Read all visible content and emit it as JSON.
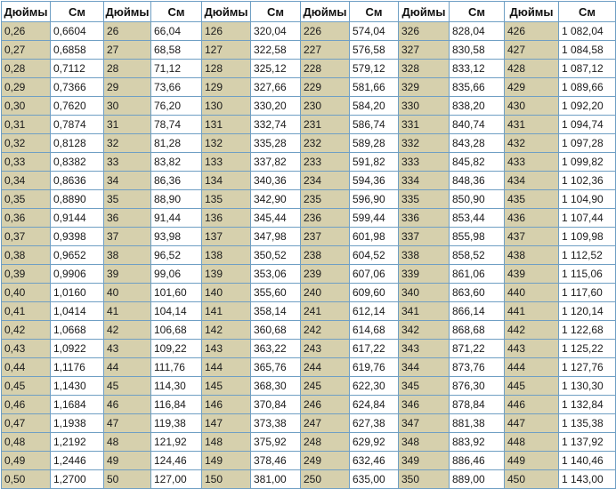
{
  "table": {
    "headers": [
      "Дюймы",
      "См",
      "Дюймы",
      "См",
      "Дюймы",
      "См",
      "Дюймы",
      "См",
      "Дюймы",
      "См",
      "Дюймы",
      "См"
    ],
    "rows": [
      [
        "0,26",
        "0,6604",
        "26",
        "66,04",
        "126",
        "320,04",
        "226",
        "574,04",
        "326",
        "828,04",
        "426",
        "1 082,04"
      ],
      [
        "0,27",
        "0,6858",
        "27",
        "68,58",
        "127",
        "322,58",
        "227",
        "576,58",
        "327",
        "830,58",
        "427",
        "1 084,58"
      ],
      [
        "0,28",
        "0,7112",
        "28",
        "71,12",
        "128",
        "325,12",
        "228",
        "579,12",
        "328",
        "833,12",
        "428",
        "1 087,12"
      ],
      [
        "0,29",
        "0,7366",
        "29",
        "73,66",
        "129",
        "327,66",
        "229",
        "581,66",
        "329",
        "835,66",
        "429",
        "1 089,66"
      ],
      [
        "0,30",
        "0,7620",
        "30",
        "76,20",
        "130",
        "330,20",
        "230",
        "584,20",
        "330",
        "838,20",
        "430",
        "1 092,20"
      ],
      [
        "0,31",
        "0,7874",
        "31",
        "78,74",
        "131",
        "332,74",
        "231",
        "586,74",
        "331",
        "840,74",
        "431",
        "1 094,74"
      ],
      [
        "0,32",
        "0,8128",
        "32",
        "81,28",
        "132",
        "335,28",
        "232",
        "589,28",
        "332",
        "843,28",
        "432",
        "1 097,28"
      ],
      [
        "0,33",
        "0,8382",
        "33",
        "83,82",
        "133",
        "337,82",
        "233",
        "591,82",
        "333",
        "845,82",
        "433",
        "1 099,82"
      ],
      [
        "0,34",
        "0,8636",
        "34",
        "86,36",
        "134",
        "340,36",
        "234",
        "594,36",
        "334",
        "848,36",
        "434",
        "1 102,36"
      ],
      [
        "0,35",
        "0,8890",
        "35",
        "88,90",
        "135",
        "342,90",
        "235",
        "596,90",
        "335",
        "850,90",
        "435",
        "1 104,90"
      ],
      [
        "0,36",
        "0,9144",
        "36",
        "91,44",
        "136",
        "345,44",
        "236",
        "599,44",
        "336",
        "853,44",
        "436",
        "1 107,44"
      ],
      [
        "0,37",
        "0,9398",
        "37",
        "93,98",
        "137",
        "347,98",
        "237",
        "601,98",
        "337",
        "855,98",
        "437",
        "1 109,98"
      ],
      [
        "0,38",
        "0,9652",
        "38",
        "96,52",
        "138",
        "350,52",
        "238",
        "604,52",
        "338",
        "858,52",
        "438",
        "1 112,52"
      ],
      [
        "0,39",
        "0,9906",
        "39",
        "99,06",
        "139",
        "353,06",
        "239",
        "607,06",
        "339",
        "861,06",
        "439",
        "1 115,06"
      ],
      [
        "0,40",
        "1,0160",
        "40",
        "101,60",
        "140",
        "355,60",
        "240",
        "609,60",
        "340",
        "863,60",
        "440",
        "1 117,60"
      ],
      [
        "0,41",
        "1,0414",
        "41",
        "104,14",
        "141",
        "358,14",
        "241",
        "612,14",
        "341",
        "866,14",
        "441",
        "1 120,14"
      ],
      [
        "0,42",
        "1,0668",
        "42",
        "106,68",
        "142",
        "360,68",
        "242",
        "614,68",
        "342",
        "868,68",
        "442",
        "1 122,68"
      ],
      [
        "0,43",
        "1,0922",
        "43",
        "109,22",
        "143",
        "363,22",
        "243",
        "617,22",
        "343",
        "871,22",
        "443",
        "1 125,22"
      ],
      [
        "0,44",
        "1,1176",
        "44",
        "111,76",
        "144",
        "365,76",
        "244",
        "619,76",
        "344",
        "873,76",
        "444",
        "1 127,76"
      ],
      [
        "0,45",
        "1,1430",
        "45",
        "114,30",
        "145",
        "368,30",
        "245",
        "622,30",
        "345",
        "876,30",
        "445",
        "1 130,30"
      ],
      [
        "0,46",
        "1,1684",
        "46",
        "116,84",
        "146",
        "370,84",
        "246",
        "624,84",
        "346",
        "878,84",
        "446",
        "1 132,84"
      ],
      [
        "0,47",
        "1,1938",
        "47",
        "119,38",
        "147",
        "373,38",
        "247",
        "627,38",
        "347",
        "881,38",
        "447",
        "1 135,38"
      ],
      [
        "0,48",
        "1,2192",
        "48",
        "121,92",
        "148",
        "375,92",
        "248",
        "629,92",
        "348",
        "883,92",
        "448",
        "1 137,92"
      ],
      [
        "0,49",
        "1,2446",
        "49",
        "124,46",
        "149",
        "378,46",
        "249",
        "632,46",
        "349",
        "886,46",
        "449",
        "1 140,46"
      ],
      [
        "0,50",
        "1,2700",
        "50",
        "127,00",
        "150",
        "381,00",
        "250",
        "635,00",
        "350",
        "889,00",
        "450",
        "1 143,00"
      ]
    ]
  },
  "colors": {
    "inches_cell_bg": "#d6d0ad",
    "cm_cell_bg": "#ffffff",
    "border": "#6f9fc4"
  }
}
